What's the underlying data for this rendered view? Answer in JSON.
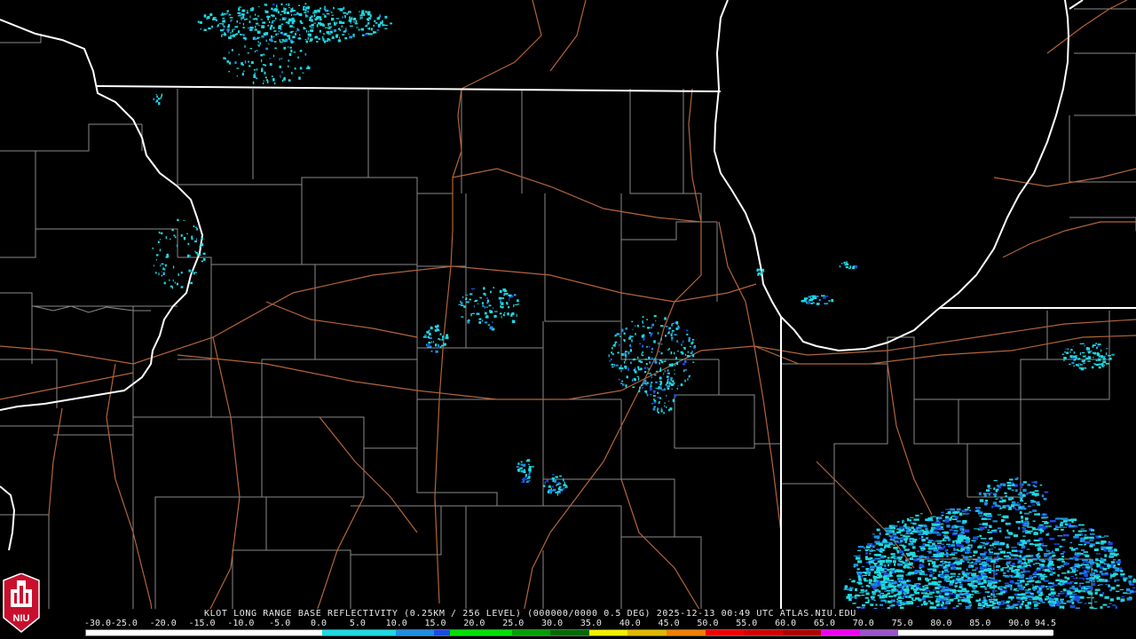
{
  "product": {
    "caption": "KLOT LONG RANGE BASE REFLECTIVITY (0.25KM / 256 LEVEL) (000000/0000 0.5 DEG) 2025-12-13 00:49 UTC  ATLAS.NIU.EDU"
  },
  "logo": {
    "text": "NIU",
    "icon": "university-tower-icon"
  },
  "colors": {
    "background": "#000000",
    "state_border": "#ffffff",
    "county_border": "#8a8a8a",
    "highway": "#b3643a",
    "echo_light": "#1fd8e0",
    "echo_mid": "#1f8fe0",
    "echo_strong": "#1a4ce0"
  },
  "color_scale": {
    "labels": [
      "-30.0",
      "-25.0",
      "-20.0",
      "-15.0",
      "-10.0",
      "-5.0",
      "0.0",
      "5.0",
      "10.0",
      "15.0",
      "20.0",
      "25.0",
      "30.0",
      "35.0",
      "40.0",
      "45.0",
      "50.0",
      "55.0",
      "60.0",
      "65.0",
      "70.0",
      "75.0",
      "80.0",
      "85.0",
      "90.0",
      "94.5"
    ],
    "colors": [
      "#ffffff",
      "#ffffff",
      "#ffffff",
      "#ffffff",
      "#ffffff",
      "#ffffff",
      "#ffffff",
      "#ffffff",
      "#ffffff",
      "#ffffff",
      "#ffffff",
      "#ffffff",
      "#ffffff",
      "#ffffff",
      "#ffffff",
      "#ffffff",
      "#ffffff",
      "#ffffff",
      "#ffffff",
      "#ffffff",
      "#ffffff",
      "#ffffff",
      "#ffffff",
      "#ffffff",
      "#ffffff",
      "#ffffff",
      "#ffffff",
      "#ffffff",
      "#ffffff",
      "#ffffff",
      "#ffffff",
      "#ffffff",
      "#ffffff",
      "#ffffff",
      "#ffffff",
      "#ffffff",
      "#ffffff",
      "#ffffff",
      "#ffffff",
      "#ffffff",
      "#ffffff",
      "#ffffff",
      "#ffffff",
      "#ffffff",
      "#ffffff",
      "#ffffff",
      "#ffffff",
      "#ffffff",
      "#ffffff",
      "#ffffff",
      "#ffffff",
      "#ffffff",
      "#ffffff",
      "#ffffff",
      "#ffffff",
      "#ffffff",
      "#ffffff",
      "#ffffff",
      "#ffffff",
      "#ffffff",
      "#ffffff",
      "#ffffff",
      "#ffffff",
      "#ffffff",
      "#ffffff",
      "#ffffff",
      "#ffffff",
      "#ffffff",
      "#ffffff",
      "#ffffff",
      "#ffffff",
      "#ffffff",
      "#ffffff",
      "#ffffff",
      "#ffffff",
      "#ffffff",
      "#ffffff",
      "#ffffff",
      "#ffffff",
      "#ffffff",
      "#ffffff",
      "#ffffff",
      "#ffffff",
      "#ffffff",
      "#ffffff",
      "#ffffff",
      "#ffffff",
      "#ffffff",
      "#ffffff",
      "#ffffff",
      "#ffffff",
      "#ffffff",
      "#ffffff",
      "#ffffff",
      "#ffffff",
      "#ffffff",
      "#ffffff",
      "#ffffff",
      "#ffffff",
      "#ffffff",
      "#ffffff",
      "#ffffff",
      "#ffffff",
      "#ffffff",
      "#ffffff",
      "#ffffff",
      "#ffffff",
      "#ffffff",
      "#ffffff",
      "#ffffff",
      "#ffffff",
      "#ffffff",
      "#ffffff",
      "#ffffff",
      "#ffffff",
      "#ffffff",
      "#ffffff",
      "#ffffff",
      "#ffffff",
      "#ffffff",
      "#ffffff",
      "#ffffff",
      "#ffffff",
      "#ffffff",
      "#ffffff",
      "#ffffff",
      "#ffffff",
      "#ffffff",
      "#ffffff",
      "#ffffff",
      "#ffffff",
      "#ffffff",
      "#ffffff",
      "#ffffff",
      "#ffffff",
      "#ffffff",
      "#ffffff",
      "#ffffff",
      "#ffffff",
      "#ffffff",
      "#ffffff",
      "#ffffff",
      "#ffffff",
      "#ffffff",
      "#ffffff",
      "#ffffff",
      "#ffffff",
      "#ffffff",
      "#ffffff",
      "#ffffff",
      "#ffffff",
      "#ffffff",
      "#ffffff",
      "#ffffff",
      "#ffffff",
      "#ffffff",
      "#ffffff",
      "#ffffff",
      "#ffffff",
      "#ffffff",
      "#ffffff",
      "#ffffff",
      "#ffffff",
      "#ffffff",
      "#ffffff",
      "#ffffff",
      "#ffffff",
      "#ffffff",
      "#ffffff",
      "#ffffff",
      "#ffffff",
      "#ffffff",
      "#ffffff",
      "#ffffff",
      "#ffffff",
      "#ffffff",
      "#ffffff",
      "#ffffff",
      "#ffffff",
      "#ffffff",
      "#ffffff",
      "#ffffff",
      "#ffffff",
      "#ffffff",
      "#ffffff",
      "#ffffff",
      "#ffffff",
      "#ffffff",
      "#ffffff",
      "#ffffff",
      "#ffffff",
      "#ffffff",
      "#ffffff",
      "#ffffff",
      "#ffffff",
      "#ffffff",
      "#ffffff",
      "#ffffff",
      "#ffffff",
      "#ffffff",
      "#ffffff",
      "#ffffff",
      "#ffffff",
      "#ffffff",
      "#ffffff",
      "#ffffff",
      "#ffffff",
      "#ffffff",
      "#ffffff",
      "#ffffff",
      "#ffffff",
      "#ffffff",
      "#ffffff",
      "#ffffff",
      "#ffffff",
      "#ffffff",
      "#ffffff",
      "#ffffff",
      "#ffffff",
      "#ffffff",
      "#ffffff",
      "#ffffff",
      "#ffffff",
      "#ffffff",
      "#ffffff",
      "#ffffff",
      "#ffffff",
      "#ffffff",
      "#ffffff",
      "#ffffff",
      "#ffffff",
      "#ffffff",
      "#ffffff",
      "#ffffff",
      "#ffffff",
      "#ffffff",
      "#ffffff",
      "#ffffff",
      "#ffffff",
      "#ffffff"
    ],
    "stops": [
      {
        "value": -30.0,
        "color": "#ffffff"
      },
      {
        "value": 0.0,
        "color": "#ffffff"
      },
      {
        "value": 0.1,
        "color": "#1fd8e0"
      },
      {
        "value": 10.0,
        "color": "#1f8fe0"
      },
      {
        "value": 15.0,
        "color": "#1a4ce0"
      },
      {
        "value": 17.0,
        "color": "#00e000"
      },
      {
        "value": 25.0,
        "color": "#00a000"
      },
      {
        "value": 30.0,
        "color": "#006a00"
      },
      {
        "value": 35.0,
        "color": "#f0f000"
      },
      {
        "value": 40.0,
        "color": "#e0b800"
      },
      {
        "value": 45.0,
        "color": "#f08000"
      },
      {
        "value": 50.0,
        "color": "#f00000"
      },
      {
        "value": 55.0,
        "color": "#d00000"
      },
      {
        "value": 60.0,
        "color": "#b00000"
      },
      {
        "value": 65.0,
        "color": "#f000f0"
      },
      {
        "value": 70.0,
        "color": "#9a55c8"
      },
      {
        "value": 75.0,
        "color": "#ffffff"
      },
      {
        "value": 94.5,
        "color": "#ffffff"
      }
    ]
  }
}
